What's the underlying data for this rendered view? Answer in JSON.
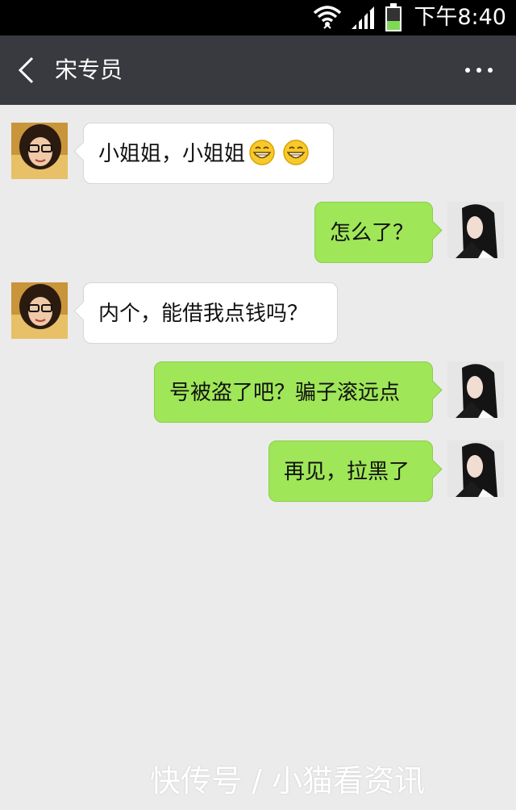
{
  "status_bar": {
    "time": "下午8:40",
    "icons": [
      "wifi-icon",
      "signal-icon",
      "battery-icon"
    ]
  },
  "nav": {
    "back_icon": "chevron-left-icon",
    "title": "宋专员",
    "more_icon": "more-dots-icon"
  },
  "messages": [
    {
      "side": "left",
      "text": "小姐姐，小姐姐",
      "emojis": [
        "grin-emoji",
        "grin-emoji"
      ]
    },
    {
      "side": "right",
      "text": "怎么了？"
    },
    {
      "side": "left",
      "text": "内个，能借我点钱吗？"
    },
    {
      "side": "right",
      "text": "号被盗了吧？骗子滚远点"
    },
    {
      "side": "right",
      "text": "再见，拉黑了"
    }
  ],
  "watermark": "快传号 / 小猫看资讯",
  "colors": {
    "nav_bg": "#393a3f",
    "chat_bg": "#ebebeb",
    "outgoing_bubble": "#9fe658",
    "incoming_bubble": "#ffffff",
    "battery_green": "#7ed957"
  }
}
